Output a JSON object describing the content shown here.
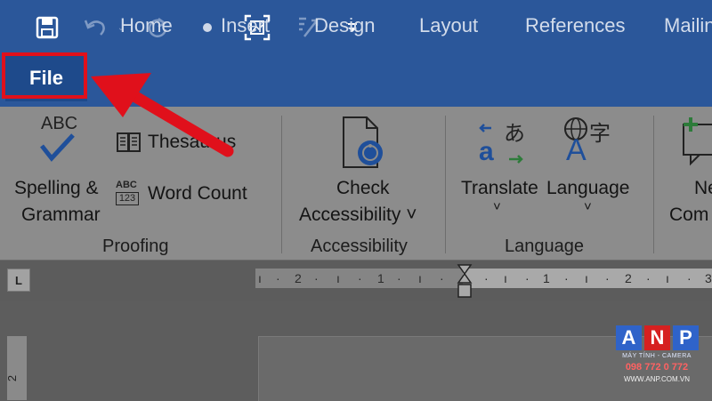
{
  "title_bar": {
    "quick_access": [
      {
        "name": "save-icon",
        "glyph": "💾"
      },
      {
        "name": "undo-icon",
        "glyph": "↶"
      },
      {
        "name": "redo-icon",
        "glyph": "↻"
      },
      {
        "name": "touch-mode-icon",
        "glyph": "●"
      },
      {
        "name": "screenshot-icon",
        "glyph": "⛶"
      },
      {
        "name": "format-painter-icon",
        "glyph": "⇲"
      },
      {
        "name": "customize-qat-icon",
        "glyph": "⏷"
      }
    ]
  },
  "tabs": {
    "file": "File",
    "home": "Home",
    "insert": "Insert",
    "design": "Design",
    "layout": "Layout",
    "references": "References",
    "mailings": "Mailin"
  },
  "ribbon": {
    "proofing": {
      "spelling_line1": "Spelling &",
      "spelling_line2": "Grammar",
      "abc_text": "ABC",
      "thesaurus": "Thesaurus",
      "word_count": "Word Count",
      "word_count_icon_text": "ABC",
      "word_count_icon_num": "123",
      "group_label": "Proofing"
    },
    "accessibility": {
      "check_line1": "Check",
      "check_line2": "Accessibility ˅",
      "group_label": "Accessibility"
    },
    "language": {
      "translate": "Translate",
      "language": "Language",
      "translate_icon_text": "a",
      "translate_icon_jp": "あ",
      "language_icon_text": "A",
      "language_icon_cn": "字",
      "group_label": "Language"
    },
    "comments": {
      "new_line1": "Ne",
      "new_line2": "Com"
    }
  },
  "ruler": {
    "labels": [
      "2",
      "1",
      "1",
      "2",
      "3"
    ],
    "tab_selector": "L",
    "vertical_label": "2"
  },
  "watermark": {
    "letters": [
      "A",
      "N",
      "P"
    ],
    "colors": [
      "#2f63c9",
      "#d62020",
      "#2f63c9"
    ],
    "subtitle": "MÁY TÍNH - CAMERA",
    "phone": "098 772 0 772",
    "url": "WWW.ANP.COM.VN"
  },
  "colors": {
    "accent": "#2b579a",
    "highlight": "#e0101b"
  }
}
